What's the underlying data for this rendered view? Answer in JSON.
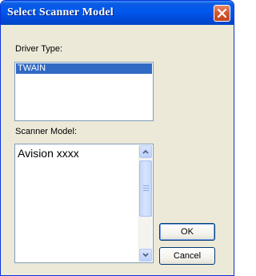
{
  "window": {
    "title": "Select Scanner Model"
  },
  "driver_type": {
    "label": "Driver Type:",
    "selected": "TWAIN"
  },
  "scanner_model": {
    "label": "Scanner Model:",
    "items": [
      "Avision xxxx"
    ]
  },
  "buttons": {
    "ok": "OK",
    "cancel": "Cancel"
  },
  "icons": {
    "close": "close-icon",
    "scroll_up": "chevron-up-icon",
    "scroll_down": "chevron-down-icon"
  },
  "colors": {
    "titlebar": "#0054e3",
    "close": "#d45a2f",
    "selection": "#316ac5",
    "dialog_bg": "#ece9d8"
  }
}
